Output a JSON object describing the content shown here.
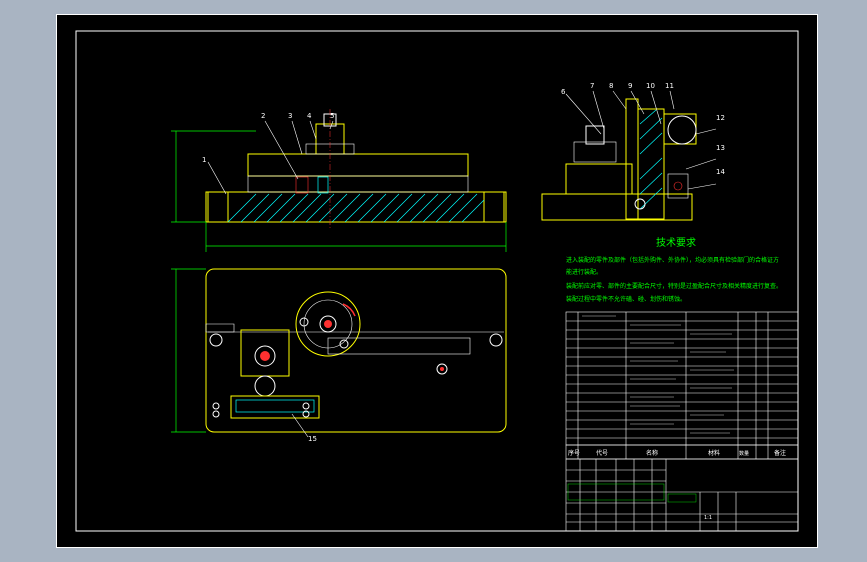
{
  "part_numbers": [
    "1",
    "2",
    "3",
    "4",
    "5",
    "6",
    "7",
    "8",
    "9",
    "10",
    "11",
    "12",
    "13",
    "14",
    "15"
  ],
  "tech_req": {
    "title": "技术要求",
    "lines": [
      "进入装配的零件及部件（包括外购件、外协件），均必须具有检验部门的合格证方",
      "能进行装配。",
      "装配前应对零、部件的主要配合尺寸，特别是过盈配合尺寸及相关精度进行复查。",
      "装配过程中零件不允许磕、碰、划伤和锈蚀。"
    ]
  },
  "bom_header": {
    "no": "序号",
    "code": "代号",
    "name": "名称",
    "material": "材料",
    "qty": "数量",
    "remark": "备注"
  },
  "title_block": {
    "scale": "1:1"
  },
  "colors": {
    "sheet_background": "#000000",
    "frame": "#ffffff",
    "dimensions": "#00ff00",
    "outline": "#ffff00",
    "hidden": "#00ffff"
  }
}
